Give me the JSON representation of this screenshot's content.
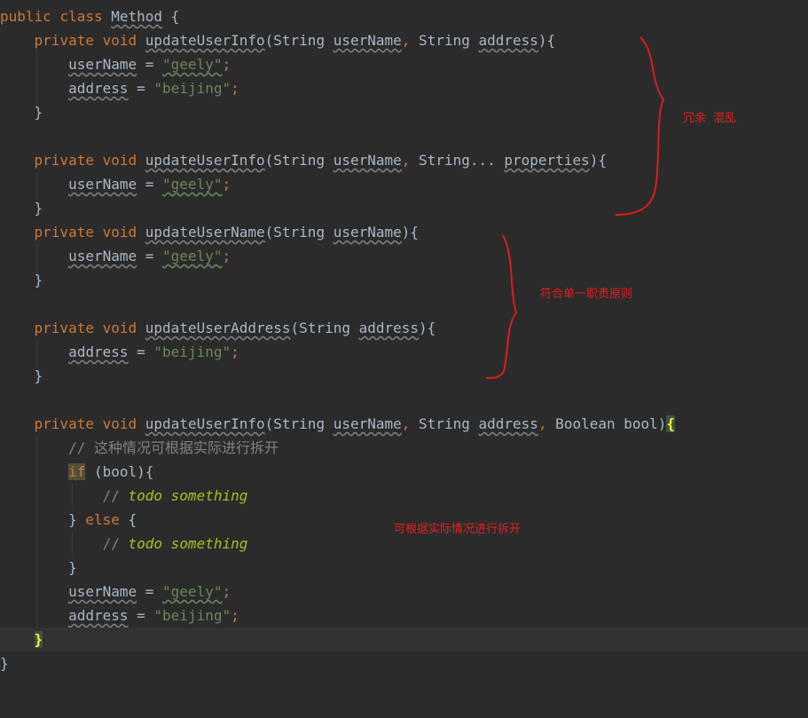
{
  "code": {
    "l1": {
      "kw1": "public",
      "kw2": "class",
      "name": "Method",
      "rest": " {"
    },
    "l2": {
      "kw1": "private",
      "kw2": "void",
      "fn": "updateUserInfo",
      "p1": "(String ",
      "a1": "userName",
      "c1": ",",
      "p2": " String ",
      "a2": "address",
      "end": "){"
    },
    "l3": {
      "var": "userName",
      "eq": " = ",
      "val": "\"geely\"",
      "semi": ";"
    },
    "l4": {
      "var": "address",
      "eq": " = ",
      "val": "\"beijing\"",
      "semi": ";"
    },
    "l5": {
      "text": "}"
    },
    "l7": {
      "kw1": "private",
      "kw2": "void",
      "fn": "updateUserInfo",
      "p1": "(String ",
      "a1": "userName",
      "c1": ",",
      "p2": " String... ",
      "a2": "properties",
      "end": "){"
    },
    "l8": {
      "var": "userName",
      "eq": " = ",
      "val": "\"geely\"",
      "semi": ";"
    },
    "l9": {
      "text": "}"
    },
    "l10": {
      "kw1": "private",
      "kw2": "void",
      "fn": "updateUserName",
      "p1": "(String ",
      "a1": "userName",
      "end": "){"
    },
    "l11": {
      "var": "userName",
      "eq": " = ",
      "val": "\"geely\"",
      "semi": ";"
    },
    "l12": {
      "text": "}"
    },
    "l14": {
      "kw1": "private",
      "kw2": "void",
      "fn": "updateUserAddress",
      "p1": "(String ",
      "a1": "address",
      "end": "){"
    },
    "l15": {
      "var": "address",
      "eq": " = ",
      "val": "\"beijing\"",
      "semi": ";"
    },
    "l16": {
      "text": "}"
    },
    "l18": {
      "kw1": "private",
      "kw2": "void",
      "fn": "updateUserInfo",
      "p1": "(String ",
      "a1": "userName",
      "c1": ",",
      "p2": " String ",
      "a2": "address",
      "c2": ",",
      "p3": " Boolean bool)",
      "brace": "{"
    },
    "l19": {
      "comment": "// 这种情况可根据实际进行拆开"
    },
    "l20": {
      "kw": "if",
      "rest": " (bool){"
    },
    "l21": {
      "slashes": "// ",
      "todo": "todo something"
    },
    "l22": {
      "open": "} ",
      "kw": "else",
      "rest": " {"
    },
    "l23": {
      "slashes": "// ",
      "todo": "todo something"
    },
    "l24": {
      "text": "}"
    },
    "l25": {
      "var": "userName",
      "eq": " = ",
      "val": "\"geely\"",
      "semi": ";"
    },
    "l26": {
      "var": "address",
      "eq": " = ",
      "val": "\"beijing\"",
      "semi": ";"
    },
    "l27": {
      "brace": "}"
    },
    "l28": {
      "text": "}"
    }
  },
  "annotations": {
    "redundant": "冗余  混乱",
    "single_responsibility": "符合单一职责原则",
    "split": "可根据实际情况进行拆开"
  },
  "colors": {
    "background": "#2b2b2b",
    "keyword": "#cc7832",
    "string": "#6a8759",
    "todo": "#a8c023",
    "annotation": "#e02020"
  }
}
